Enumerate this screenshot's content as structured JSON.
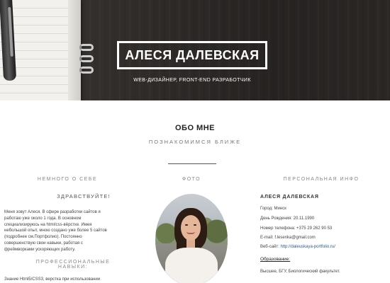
{
  "hero": {
    "name": "АЛЕСЯ ДАЛЕВСКАЯ",
    "subtitle": "WEB-ДИЗАЙНЕР, FRONT-END РАЗРАБОТЧИК"
  },
  "about": {
    "title": "ОБО МНЕ",
    "subtitle": "ПОЗНАКОМИМСЯ БЛИЖЕ"
  },
  "columns": {
    "about_me": "НЕМНОГО О СЕБЕ",
    "photo": "ФОТО",
    "personal_info": "ПЕРСОНАЛЬНАЯ ИНФО"
  },
  "left": {
    "greeting": "ЗДРАВСТВУЙТЕ!",
    "intro_lines": [
      "Меня зовут Алеся. В сфере разработки сайтов я",
      "работаю уже около 1 года. В основном",
      "специализируюсь на html/css-вёрстке. Имея",
      "небольшой опыт, мною создано уже более 5 сайтов",
      "(подробнее см.Портфолио). Постоянно",
      "совершенствую свои навыки, работая с",
      "фреймворками ускоряющих работу."
    ],
    "skills_title": "ПРОФЕССИОНАЛЬНЫЕ НАВЫКИ:",
    "skills_line": "Знание Html5/CSS3, верстка при использовании"
  },
  "info": {
    "name": "АЛЕСЯ ДАЛЕВСКАЯ",
    "city": "Город: Минск",
    "birthday": "День Рождения: 20.11.1990",
    "phone": "Номер телефона: +375 29 262 90 53",
    "email": "E-mail: f.lesenka@gmail.com",
    "website_label": "Веб-сайт: ",
    "website_url": "http://daleuskaya-portfolio.ru/",
    "education_label": "Образование:",
    "education_text": "Высшее, БГУ, Биологический факультет."
  }
}
